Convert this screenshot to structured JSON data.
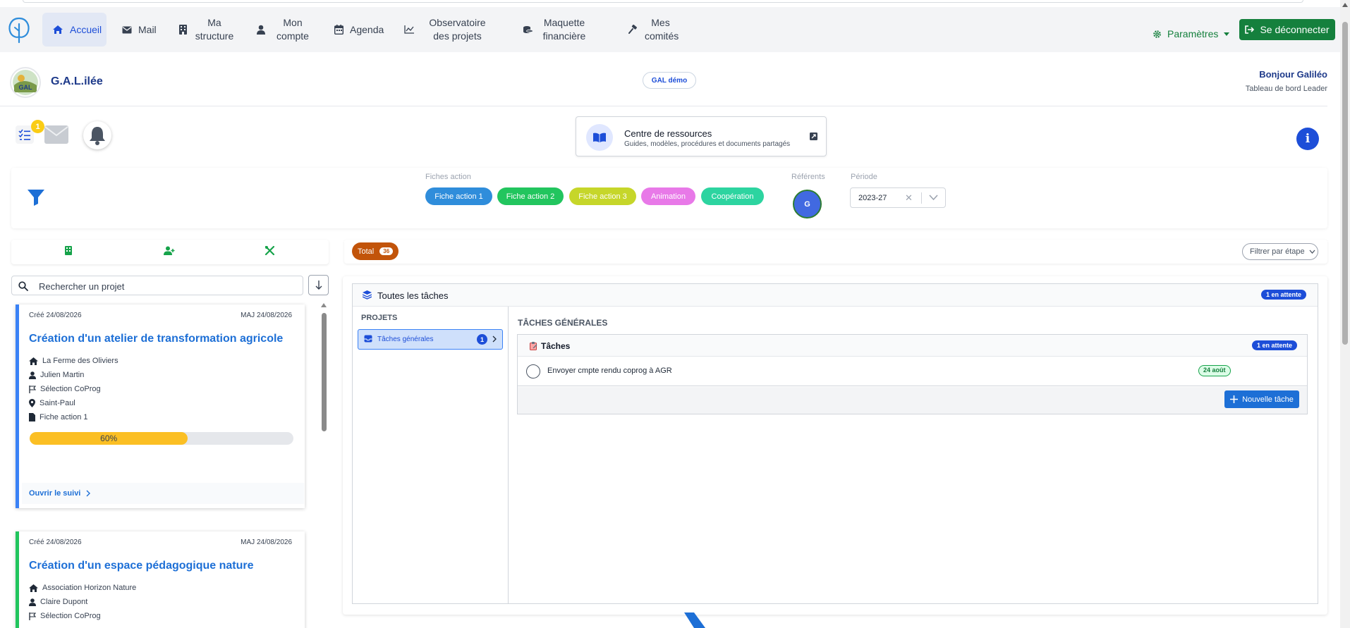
{
  "nav": {
    "items": [
      {
        "label": "Accueil"
      },
      {
        "label": "Mail"
      },
      {
        "label": "Ma structure"
      },
      {
        "label": "Mon compte"
      },
      {
        "label": "Agenda"
      },
      {
        "label": "Observatoire des projets"
      },
      {
        "label": "Maquette financière"
      },
      {
        "label": "Mes comités"
      }
    ],
    "settings_label": "Paramètres",
    "logout_label": "Se déconnecter"
  },
  "header": {
    "org_name": "G.A.L.ilée",
    "org_logo_text": "GAL",
    "env_badge": "GAL démo",
    "greeting": "Bonjour Galiléo",
    "dashboard_label": "Tableau de bord Leader"
  },
  "notifications": {
    "tasks_count": "1"
  },
  "resources": {
    "title": "Centre de ressources",
    "subtitle": "Guides, modèles, procédures et documents partagés"
  },
  "filters": {
    "fiches_label": "Fiches action",
    "fiches": [
      {
        "label": "Fiche action 1",
        "color": "#2f8ddb"
      },
      {
        "label": "Fiche action 2",
        "color": "#22c55e"
      },
      {
        "label": "Fiche action 3",
        "color": "#c6d62a"
      },
      {
        "label": "Animation",
        "color": "#e879e8"
      },
      {
        "label": "Coopération",
        "color": "#2dd4a0"
      }
    ],
    "referents_label": "Référents",
    "referent_initial": "G",
    "period_label": "Période",
    "period_value": "2023-27"
  },
  "projects": {
    "search_placeholder": "Rechercher un projet",
    "cards": [
      {
        "created": "Créé 24/08/2026",
        "updated": "MAJ 24/08/2026",
        "title": "Création d'un atelier de transformation agricole",
        "structure": "La Ferme des Oliviers",
        "person": "Julien Martin",
        "stage": "Sélection CoProg",
        "location": "Saint-Paul",
        "fiche": "Fiche action 1",
        "progress": 60,
        "progress_label": "60%",
        "follow_label": "Ouvrir le suivi"
      },
      {
        "created": "Créé 24/08/2026",
        "updated": "MAJ 24/08/2026",
        "title": "Création d'un espace pédagogique nature",
        "structure": "Association Horizon Nature",
        "person": "Claire Dupont",
        "stage": "Sélection CoProg"
      }
    ]
  },
  "tasks": {
    "total_label": "Total",
    "total_count": "36",
    "filter_step_label": "Filtrer par étape",
    "panel_title": "Toutes les tâches",
    "pending_badge": "1 en attente",
    "projects_header": "PROJETS",
    "project_items": [
      {
        "label": "Tâches générales",
        "count": "1"
      }
    ],
    "section_title": "TÂCHES GÉNÉRALES",
    "group_title": "Tâches",
    "group_pending": "1 en attente",
    "items": [
      {
        "label": "Envoyer cmpte rendu coprog à AGR",
        "due": "24 août"
      }
    ],
    "new_task_label": "Nouvelle tâche"
  }
}
